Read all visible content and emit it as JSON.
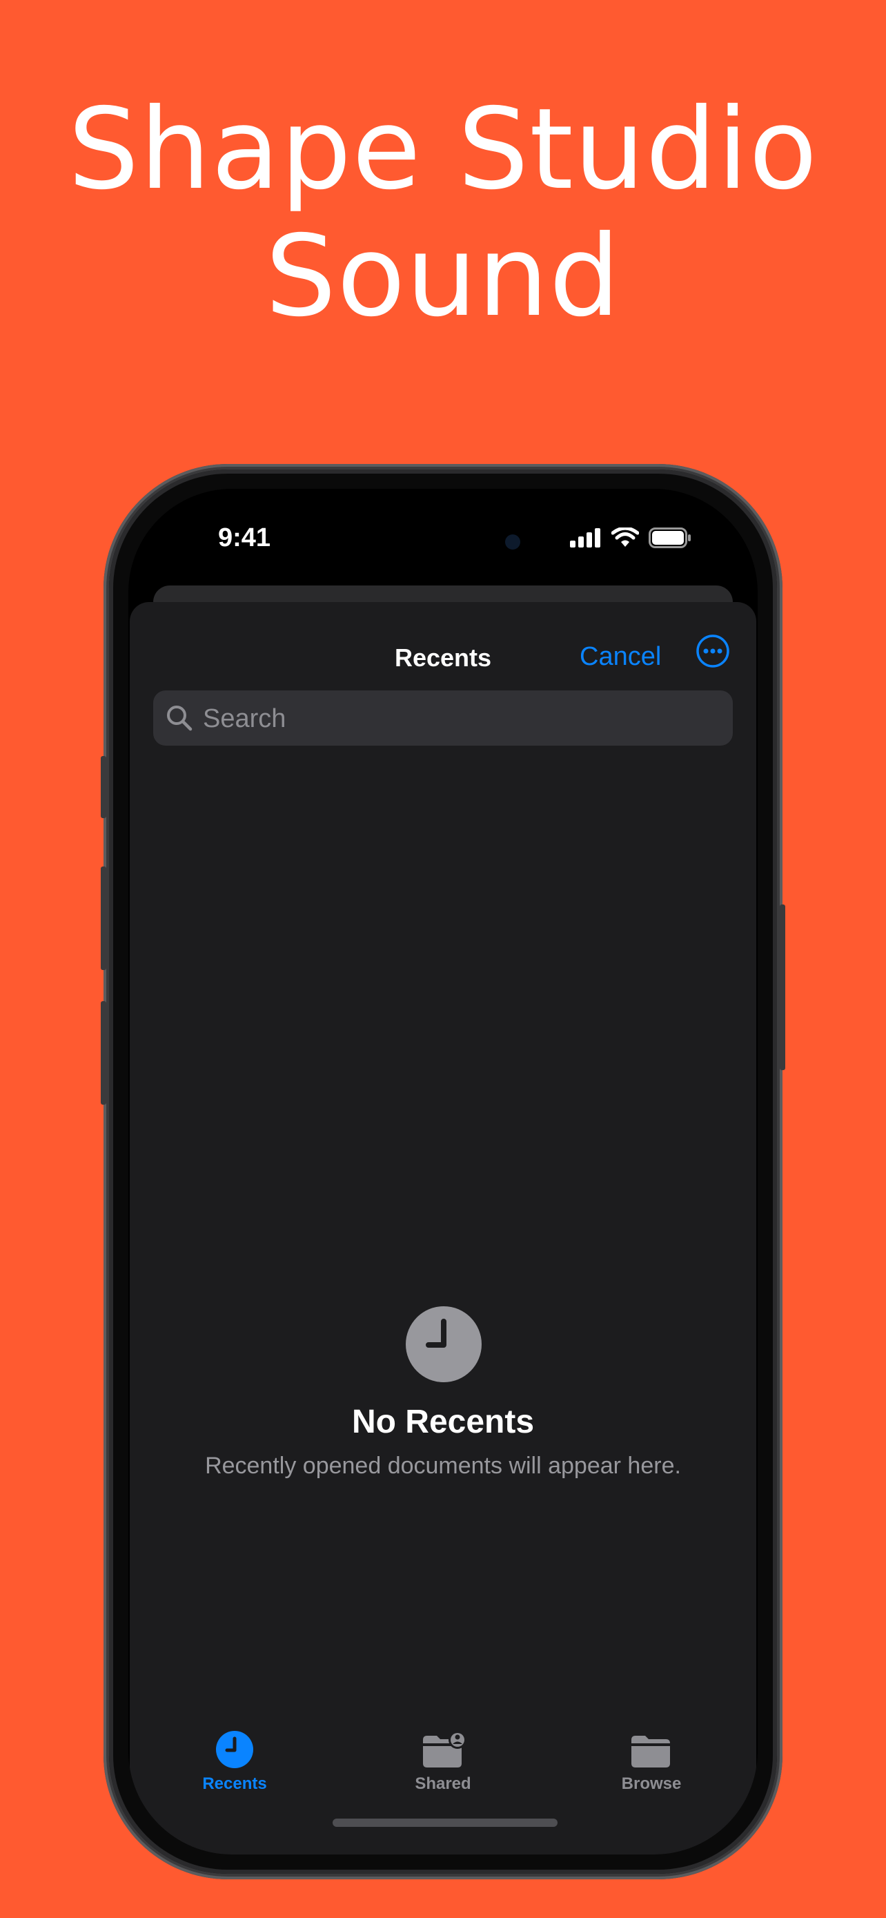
{
  "headline": {
    "line1": "Shape Studio",
    "line2": "Sound"
  },
  "status_bar": {
    "time": "9:41"
  },
  "nav": {
    "title": "Recents",
    "cancel_label": "Cancel",
    "more_icon": "ellipsis-circle-icon"
  },
  "search": {
    "placeholder": "Search",
    "icon": "magnifying-glass-icon"
  },
  "empty_state": {
    "icon": "clock-icon",
    "title": "No Recents",
    "subtitle": "Recently opened documents will appear here."
  },
  "tabs": [
    {
      "label": "Recents",
      "icon": "clock-icon",
      "active": true
    },
    {
      "label": "Shared",
      "icon": "shared-folder-icon",
      "active": false
    },
    {
      "label": "Browse",
      "icon": "folder-icon",
      "active": false
    }
  ],
  "colors": {
    "background": "#FF5A30",
    "accent": "#0A84FF",
    "sheet": "#1C1C1E",
    "inactive": "#8E8E93"
  }
}
